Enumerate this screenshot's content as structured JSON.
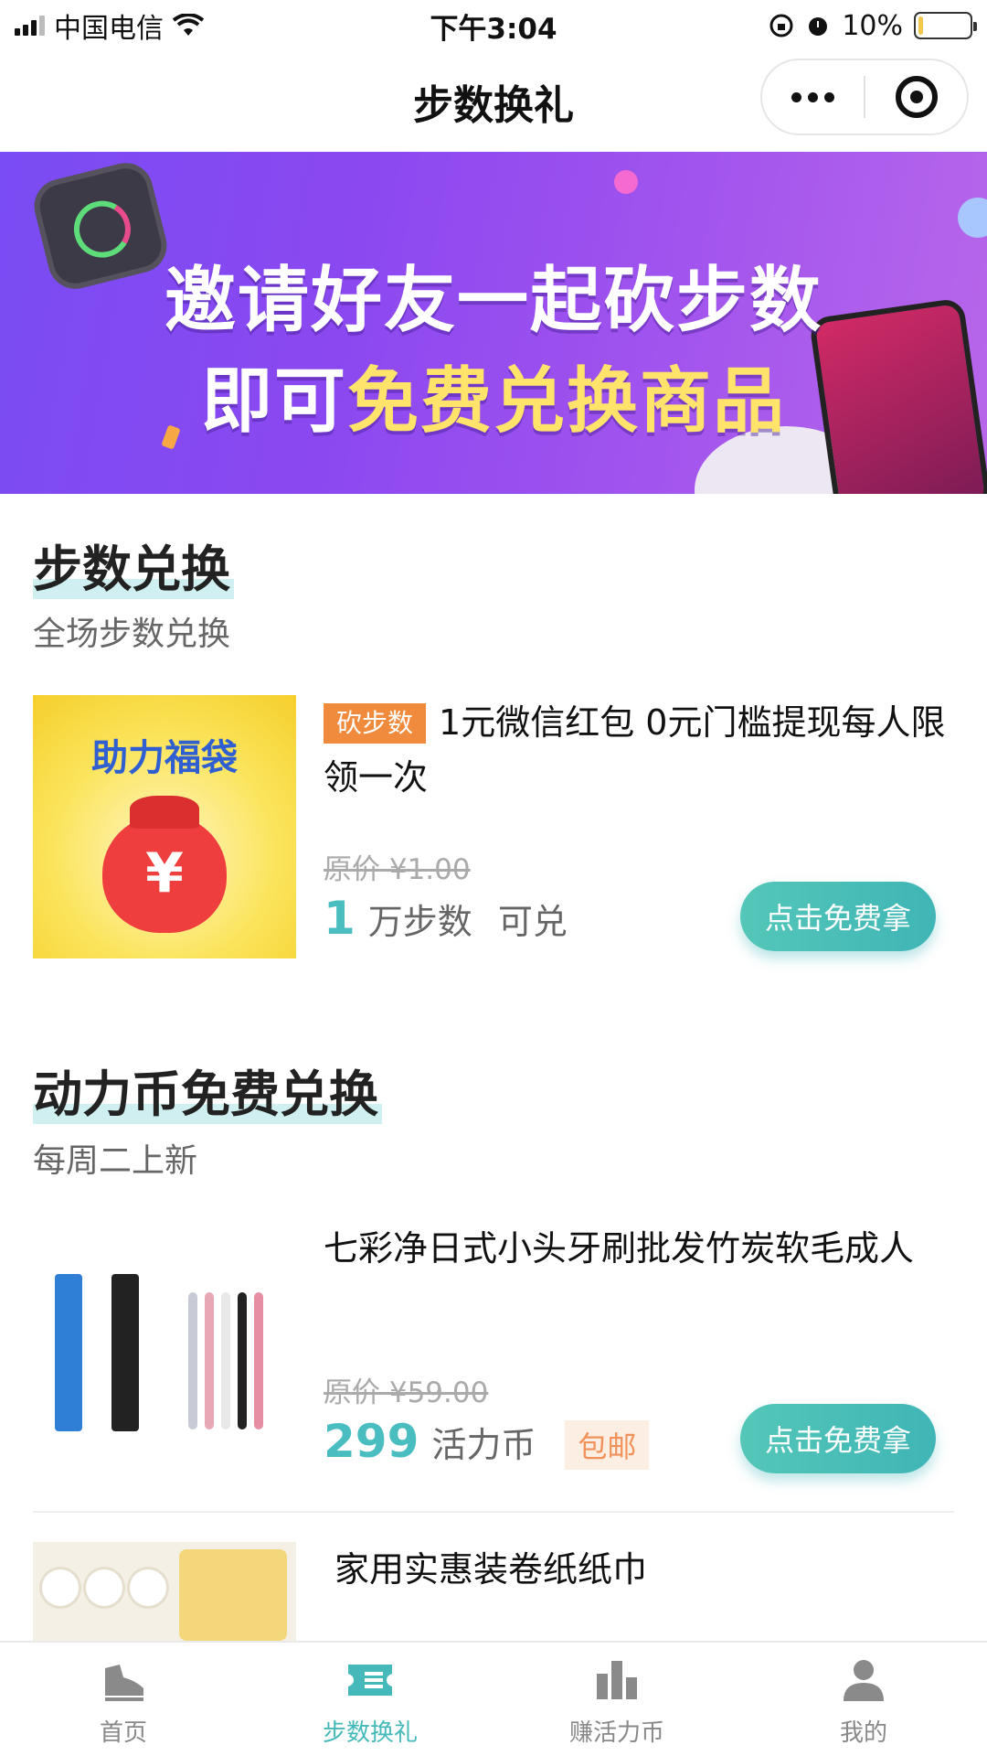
{
  "status_bar": {
    "carrier": "中国电信",
    "time": "下午3:04",
    "battery_text": "10%",
    "battery_level": 0.1
  },
  "nav": {
    "title": "步数换礼"
  },
  "banner": {
    "line1": "邀请好友一起砍步数",
    "line2_prefix": "即可",
    "line2_highlight": "免费兑换商品"
  },
  "steps_section": {
    "title": "步数兑换",
    "subtitle": "全场步数兑换",
    "product": {
      "tag": "砍步数",
      "title": "1元微信红包 0元门槛提现每人限领一次",
      "image_text": "助力福袋",
      "original_price": "原价 ¥1.00",
      "price_value": "1",
      "price_unit": "万步数",
      "price_suffix": "可兑",
      "cta": "点击免费拿"
    }
  },
  "coin_section": {
    "title": "动力币免费兑换",
    "subtitle": "每周二上新",
    "products": [
      {
        "title": " 七彩净日式小头牙刷批发竹炭软毛成人",
        "original_price": "原价 ¥59.00",
        "price_value": "299",
        "price_unit": "活力币",
        "free_shipping": "包邮",
        "cta": "点击免费拿"
      },
      {
        "title": "家用实惠装卷纸纸巾"
      }
    ]
  },
  "tab_bar": {
    "items": [
      {
        "label": "首页",
        "icon": "shoe-icon",
        "active": false
      },
      {
        "label": "步数换礼",
        "icon": "ticket-icon",
        "active": true
      },
      {
        "label": "赚活力币",
        "icon": "bar-chart-icon",
        "active": false
      },
      {
        "label": "我的",
        "icon": "person-icon",
        "active": false
      }
    ]
  },
  "colors": {
    "accent": "#45b9b9",
    "tag_orange": "#f08a3c",
    "highlight_yellow": "#ffe36b"
  }
}
